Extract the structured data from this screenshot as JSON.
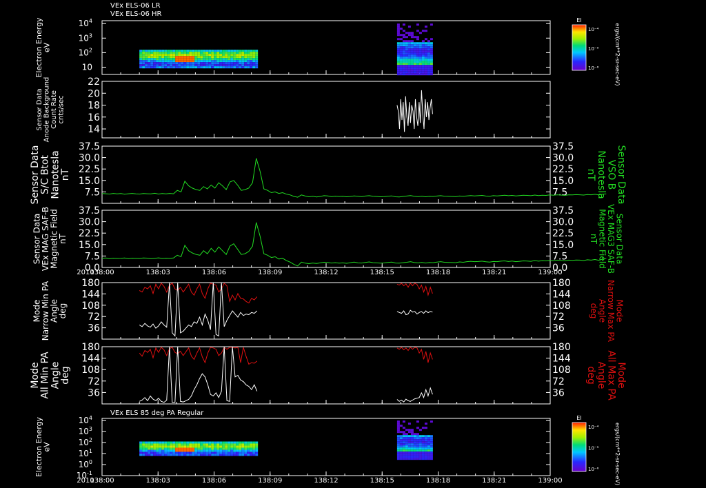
{
  "header": {
    "line1": "VEx ELS-06 LR",
    "line2": "VEx ELS-06 HR"
  },
  "year_label": "2010",
  "colors": {
    "background": "#000000",
    "frame": "#ffffff",
    "green": "#22dd22",
    "red": "#e01010",
    "white": "#ffffff"
  },
  "chart_data": [
    {
      "type": "heatmap",
      "id": "panel1",
      "ylabel": [
        "Electron Energy",
        "eV"
      ],
      "yticks": [
        {
          "base": "10",
          "exp": "4",
          "v": 4
        },
        {
          "base": "10",
          "exp": "3",
          "v": 3
        },
        {
          "base": "10",
          "exp": "2",
          "v": 2
        },
        {
          "base": "10",
          "exp": "",
          "v": 1
        }
      ],
      "ylim_log10": [
        0.5,
        4.2
      ],
      "blocks": [
        {
          "t_start": 2.0,
          "t_end": 8.3,
          "e_min": 1,
          "e_max": 2.2
        },
        {
          "t_start": 15.8,
          "t_end": 17.7,
          "e_min": 0.5,
          "e_max": 4.0
        }
      ],
      "colorbar": {
        "label": "EI",
        "ticks": [
          "10⁻⁴",
          "10⁻⁵",
          "10⁻⁶"
        ],
        "unit": "ergs/(cm**2-sr-sec-eV)"
      }
    },
    {
      "type": "line",
      "id": "panel2",
      "ylabel": [
        "Sensor Data",
        "Anode Background",
        "Count Rate",
        "cnts/sec"
      ],
      "yticks": [
        "22",
        "20",
        "18",
        "16",
        "14"
      ],
      "ylim": [
        12.5,
        22
      ],
      "series": [
        {
          "color": "#ffffff",
          "t_start": 15.8,
          "t_end": 17.7,
          "values": [
            18,
            17,
            14,
            19,
            15.5,
            18.5,
            13.5,
            19.5,
            16,
            14.5,
            18.5,
            15,
            18,
            17,
            14,
            19,
            16,
            14.5,
            18.5,
            15,
            20.5,
            16.5,
            14,
            19,
            16,
            18.5,
            15.5,
            17.5,
            19,
            16.5
          ]
        }
      ]
    },
    {
      "type": "line",
      "id": "panel3",
      "ylabel": [
        "Sensor Data",
        "S/C Btot",
        "Nanotesla",
        "nT"
      ],
      "ylabel_right": [
        "Sensor Data",
        "VSO B",
        "Nanotesla",
        "nT"
      ],
      "yticks": [
        "37.5",
        "30.0",
        "22.5",
        "15.0",
        "7.5"
      ],
      "ylim": [
        0,
        37.5
      ],
      "series": [
        {
          "color": "#22dd22",
          "t_start": 0,
          "t_end": 27,
          "values": [
            6.4,
            6.3,
            6.1,
            6.5,
            6.2,
            6.4,
            6.0,
            6.3,
            6.5,
            6.2,
            6.1,
            6.4,
            6.3,
            6.2,
            6.6,
            6.1,
            6.4,
            6.2,
            6.5,
            6.3,
            8.5,
            7.5,
            14.5,
            11.5,
            10.0,
            9.0,
            8.5,
            11.0,
            9.5,
            12.0,
            10.0,
            13.5,
            11.5,
            9.0,
            14.0,
            15.0,
            12.0,
            8.5,
            9.0,
            10.0,
            13.5,
            29.5,
            21.0,
            9.5,
            8.5,
            7.0,
            7.5,
            6.5,
            7.0,
            6.0,
            5.5,
            4.5,
            4.0,
            5.5,
            4.8,
            4.3,
            4.6,
            4.2,
            4.5,
            5.0,
            4.9,
            4.4,
            4.7,
            4.5,
            4.6,
            4.3,
            4.5,
            4.9,
            4.6,
            4.4,
            4.8,
            5.0,
            4.6,
            4.5,
            4.3,
            4.4,
            4.7,
            4.9,
            4.3,
            4.2,
            4.5,
            4.8,
            5.1,
            4.6,
            4.4,
            4.7,
            4.3,
            4.6,
            4.5,
            4.8,
            5.0,
            4.7,
            4.6,
            4.5,
            4.4,
            4.8,
            4.6,
            4.9,
            5.1,
            4.9,
            5.0,
            5.2,
            4.8,
            4.6,
            5.0,
            4.9,
            5.1,
            5.3,
            5.0,
            5.2,
            4.9,
            5.1,
            5.3,
            5.2,
            5.0,
            5.4,
            5.1,
            5.3,
            5.2,
            5.5,
            5.3,
            5.6,
            5.4,
            5.2,
            5.6,
            5.5,
            5.7,
            5.6,
            5.4,
            5.8,
            5.6,
            5.9,
            5.5,
            6.0,
            6.2
          ]
        }
      ]
    },
    {
      "type": "line",
      "id": "panel4",
      "ylabel": [
        "Sensor Data",
        "VEx MAG SAF-B",
        "Magnetic Field",
        "nT"
      ],
      "ylabel_right": [
        "Sensor Data",
        "VEx MAG3 SAF-B",
        "Magnetic Field",
        "nT"
      ],
      "yticks": [
        "37.5",
        "30.0",
        "22.5",
        "15.0",
        "7.5",
        "0.0"
      ],
      "ylim": [
        0,
        37.5
      ],
      "series": [
        {
          "color": "#22dd22",
          "t_start": 0,
          "t_end": 27,
          "values": [
            6.0,
            6.2,
            5.8,
            6.1,
            5.9,
            6.0,
            6.2,
            5.8,
            6.1,
            6.0,
            5.9,
            6.2,
            6.1,
            5.8,
            6.0,
            6.3,
            5.9,
            6.1,
            6.0,
            6.2,
            8.0,
            7.0,
            14.5,
            11.0,
            9.5,
            8.5,
            8.0,
            11.0,
            9.0,
            12.5,
            10.0,
            13.5,
            11.0,
            8.5,
            14.0,
            15.5,
            12.0,
            8.5,
            9.0,
            10.5,
            14.0,
            29.5,
            20.5,
            9.0,
            8.0,
            6.5,
            7.0,
            5.5,
            6.0,
            4.5,
            3.5,
            2.0,
            1.0,
            3.5,
            2.8,
            2.5,
            2.9,
            2.6,
            3.0,
            3.4,
            3.2,
            2.9,
            3.1,
            2.8,
            3.0,
            2.7,
            3.1,
            3.5,
            3.0,
            2.9,
            3.3,
            3.6,
            3.1,
            3.0,
            2.8,
            3.0,
            3.3,
            3.5,
            2.9,
            2.8,
            3.1,
            3.4,
            3.8,
            3.2,
            3.0,
            3.3,
            2.9,
            3.2,
            3.1,
            3.5,
            3.8,
            3.4,
            3.3,
            3.2,
            3.1,
            3.6,
            3.4,
            3.8,
            4.0,
            3.8,
            3.9,
            4.1,
            3.7,
            3.5,
            3.9,
            3.8,
            4.1,
            4.3,
            3.9,
            4.2,
            3.8,
            4.0,
            4.3,
            4.2,
            4.0,
            4.5,
            4.1,
            4.4,
            4.3,
            4.6,
            4.4,
            4.8,
            4.5,
            4.3,
            4.8,
            4.6,
            4.9,
            4.8,
            4.5,
            5.0,
            4.8,
            5.2,
            4.7,
            5.4,
            5.8
          ]
        }
      ]
    },
    {
      "type": "line",
      "id": "panel5",
      "ylabel": [
        "Mode",
        "Narrow Min PA",
        "Angle",
        "deg"
      ],
      "ylabel_right": [
        "Mode",
        "Narrow Max PA",
        "Angle",
        "deg"
      ],
      "yticks": [
        "180",
        "144",
        "108",
        "72",
        "36"
      ],
      "ylim": [
        0,
        180
      ],
      "series": [
        {
          "color": "#e01010",
          "segments": [
            {
              "t_start": 2.0,
              "t_end": 8.3,
              "values": [
                155,
                150,
                165,
                160,
                170,
                145,
                175,
                160,
                178,
                168,
                150,
                172,
                178,
                160,
                155,
                165,
                150,
                162,
                175,
                150,
                140,
                160,
                175,
                145,
                130,
                160,
                178,
                175,
                172,
                150,
                160,
                178,
                170,
                120,
                140,
                125,
                145,
                130,
                128,
                120,
                115,
                130,
                125,
                135
              ]
            },
            {
              "t_start": 15.8,
              "t_end": 17.7,
              "values": [
                175,
                172,
                178,
                170,
                176,
                165,
                178,
                170,
                178,
                174,
                160,
                172,
                150,
                168,
                140,
                165,
                145
              ]
            }
          ]
        },
        {
          "color": "#ffffff",
          "segments": [
            {
              "t_start": 2.0,
              "t_end": 8.3,
              "values": [
                45,
                40,
                50,
                42,
                38,
                48,
                35,
                42,
                55,
                45,
                38,
                180,
                20,
                10,
                180,
                20,
                25,
                35,
                45,
                40,
                55,
                50,
                70,
                45,
                80,
                60,
                30,
                180,
                15,
                10,
                180,
                40,
                60,
                75,
                90,
                80,
                70,
                85,
                75,
                80,
                78,
                85,
                82,
                90
              ]
            },
            {
              "t_start": 15.8,
              "t_end": 17.7,
              "values": [
                88,
                85,
                82,
                90,
                78,
                80,
                92,
                86,
                88,
                80,
                85,
                88,
                82,
                90,
                84,
                88,
                86
              ]
            }
          ]
        }
      ]
    },
    {
      "type": "line",
      "id": "panel6",
      "ylabel": [
        "Mode",
        "All Min PA",
        "Angle",
        "deg"
      ],
      "ylabel_right": [
        "Mode",
        "All Max PA",
        "Angle",
        "deg"
      ],
      "yticks": [
        "180",
        "144",
        "108",
        "72",
        "36"
      ],
      "ylim": [
        0,
        180
      ],
      "series": [
        {
          "color": "#e01010",
          "segments": [
            {
              "t_start": 2.0,
              "t_end": 8.3,
              "values": [
                160,
                150,
                168,
                162,
                172,
                145,
                176,
                162,
                178,
                170,
                152,
                174,
                178,
                162,
                158,
                166,
                152,
                164,
                176,
                150,
                140,
                160,
                176,
                148,
                130,
                160,
                178,
                176,
                172,
                152,
                160,
                178,
                172,
                178,
                178,
                176,
                178,
                130,
                178,
                150,
                125,
                130,
                128,
                135
              ]
            },
            {
              "t_start": 15.8,
              "t_end": 17.7,
              "values": [
                176,
                172,
                178,
                170,
                176,
                168,
                178,
                172,
                178,
                176,
                160,
                172,
                140,
                165,
                130,
                160,
                140
              ]
            }
          ]
        },
        {
          "color": "#ffffff",
          "segments": [
            {
              "t_start": 2.0,
              "t_end": 8.3,
              "values": [
                8,
                12,
                20,
                10,
                25,
                15,
                10,
                18,
                8,
                5,
                12,
                180,
                5,
                5,
                180,
                8,
                6,
                10,
                14,
                25,
                45,
                60,
                80,
                95,
                85,
                60,
                30,
                25,
                35,
                20,
                40,
                180,
                10,
                8,
                180,
                85,
                90,
                75,
                70,
                60,
                55,
                45,
                60,
                40
              ]
            },
            {
              "t_start": 15.8,
              "t_end": 17.7,
              "values": [
                14,
                8,
                12,
                6,
                15,
                10,
                8,
                12,
                16,
                18,
                20,
                35,
                20,
                45,
                25,
                50,
                30
              ]
            }
          ]
        }
      ]
    },
    {
      "type": "heatmap",
      "id": "panel7",
      "title": "VEx ELS 85 deg PA Regular",
      "ylabel": [
        "Electron Energy",
        "eV"
      ],
      "yticks": [
        {
          "base": "10",
          "exp": "4",
          "v": 4
        },
        {
          "base": "10",
          "exp": "3",
          "v": 3
        },
        {
          "base": "10",
          "exp": "2",
          "v": 2
        },
        {
          "base": "10",
          "exp": "1",
          "v": 1
        },
        {
          "base": "10",
          "exp": "0",
          "v": 0
        },
        {
          "base": "10",
          "exp": "-1",
          "v": -1
        }
      ],
      "ylim_log10": [
        -1,
        4.2
      ],
      "blocks": [
        {
          "t_start": 2.0,
          "t_end": 8.3,
          "e_min": 0.8,
          "e_max": 2.1
        },
        {
          "t_start": 15.8,
          "t_end": 17.7,
          "e_min": 0.5,
          "e_max": 4.0
        }
      ],
      "colorbar": {
        "label": "EI",
        "ticks": [
          "10⁻⁴",
          "10⁻⁵",
          "10⁻⁶"
        ],
        "unit": "ergs/(cm**2-sr-sec-eV)"
      }
    }
  ],
  "time_axis": {
    "ticks": [
      "138:00",
      "138:03",
      "138:06",
      "138:09",
      "138:12",
      "138:15",
      "138:18",
      "138:21",
      "139:00"
    ],
    "minutes": [
      0,
      3,
      6,
      9,
      12,
      15,
      18,
      21,
      24
    ]
  }
}
